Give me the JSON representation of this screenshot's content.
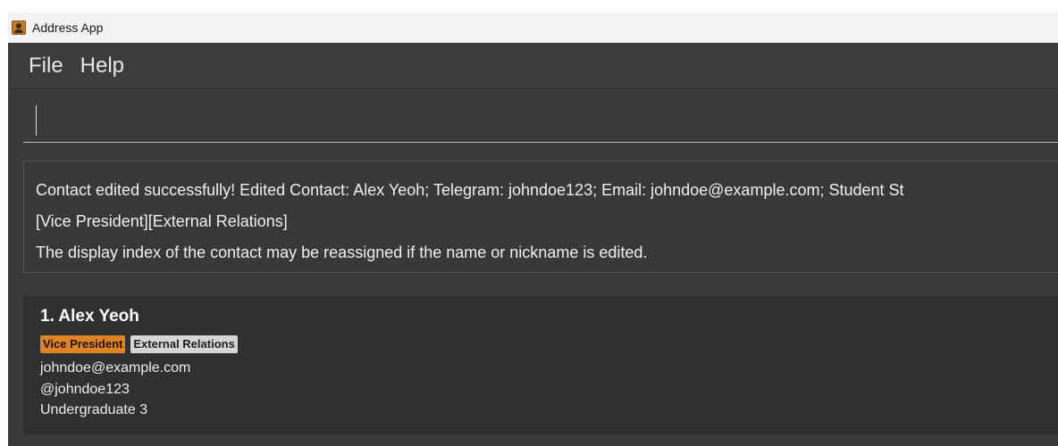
{
  "window": {
    "title": "Address App",
    "icon": "contact-book-icon"
  },
  "menubar": {
    "items": [
      "File",
      "Help"
    ]
  },
  "command": {
    "value": ""
  },
  "result": {
    "lines": [
      "Contact edited successfully! Edited Contact: Alex Yeoh; Telegram: johndoe123; Email: johndoe@example.com; Student St",
      "[Vice President][External Relations]",
      "The display index of the contact may be reassigned if the name or nickname is edited."
    ]
  },
  "contacts": [
    {
      "name": "1. Alex Yeoh",
      "tags": [
        {
          "label": "Vice President",
          "color": "#e08326"
        },
        {
          "label": "External Relations",
          "color": "#d6d6d6"
        }
      ],
      "email": "johndoe@example.com",
      "telegram": "@johndoe123",
      "status": "Undergraduate 3"
    }
  ],
  "colors": {
    "background": "#3a3a3a",
    "card": "#2f3031",
    "accent_tag": "#e08326"
  }
}
